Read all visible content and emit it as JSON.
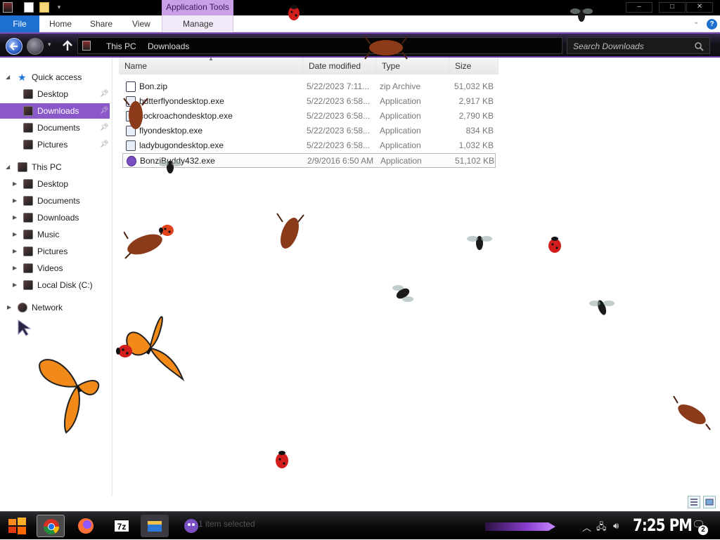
{
  "window": {
    "title": "Downloads",
    "contextual_tab": "Application Tools"
  },
  "ribbon": {
    "tabs": [
      {
        "label": "File"
      },
      {
        "label": "Home"
      },
      {
        "label": "Share"
      },
      {
        "label": "View"
      },
      {
        "label": "Manage"
      }
    ],
    "help": "?"
  },
  "address_bar": {
    "breadcrumbs": [
      "This PC",
      "Downloads"
    ],
    "search_placeholder": "Search Downloads"
  },
  "nav_pane": {
    "quick_access": {
      "label": "Quick access",
      "items": [
        {
          "label": "Desktop",
          "pinned": true
        },
        {
          "label": "Downloads",
          "pinned": true,
          "selected": true
        },
        {
          "label": "Documents",
          "pinned": true
        },
        {
          "label": "Pictures",
          "pinned": true
        }
      ]
    },
    "this_pc": {
      "label": "This PC",
      "items": [
        {
          "label": "Desktop"
        },
        {
          "label": "Documents"
        },
        {
          "label": "Downloads"
        },
        {
          "label": "Music"
        },
        {
          "label": "Pictures"
        },
        {
          "label": "Videos"
        },
        {
          "label": "Local Disk (C:)"
        }
      ]
    },
    "network": {
      "label": "Network"
    }
  },
  "file_list": {
    "columns": [
      "Name",
      "Date modified",
      "Type",
      "Size"
    ],
    "files": [
      {
        "name": "Bon.zip",
        "date": "5/22/2023 7:11...",
        "type": "zip Archive",
        "size": "51,032 KB",
        "icon": "zip-icon"
      },
      {
        "name": "butterflyondesktop.exe",
        "date": "5/22/2023 6:58...",
        "type": "Application",
        "size": "2,917 KB",
        "icon": "setup-icon"
      },
      {
        "name": "cockroachondesktop.exe",
        "date": "5/22/2023 6:58...",
        "type": "Application",
        "size": "2,790 KB",
        "icon": "setup-icon"
      },
      {
        "name": "flyondesktop.exe",
        "date": "5/22/2023 6:58...",
        "type": "Application",
        "size": "834 KB",
        "icon": "setup-icon"
      },
      {
        "name": "ladybugondesktop.exe",
        "date": "5/22/2023 6:58...",
        "type": "Application",
        "size": "1,032 KB",
        "icon": "setup-icon"
      },
      {
        "name": "BonziBuddy432.exe",
        "date": "2/9/2016 6:50 AM",
        "type": "Application",
        "size": "51,102 KB",
        "icon": "bonzi-icon"
      }
    ]
  },
  "status_bar": {
    "text": "1 item selected"
  },
  "taskbar": {
    "apps": [
      "Chrome",
      "Firefox",
      "7-Zip",
      "File Explorer",
      "BonziBuddy"
    ],
    "sevenzip_label": "7z",
    "clock": "7:25 PM",
    "notification_count": "2"
  },
  "colors": {
    "accent": "#8a58c9",
    "file_tab": "#1d6fd0",
    "context_tab": "#c9a0e6"
  }
}
